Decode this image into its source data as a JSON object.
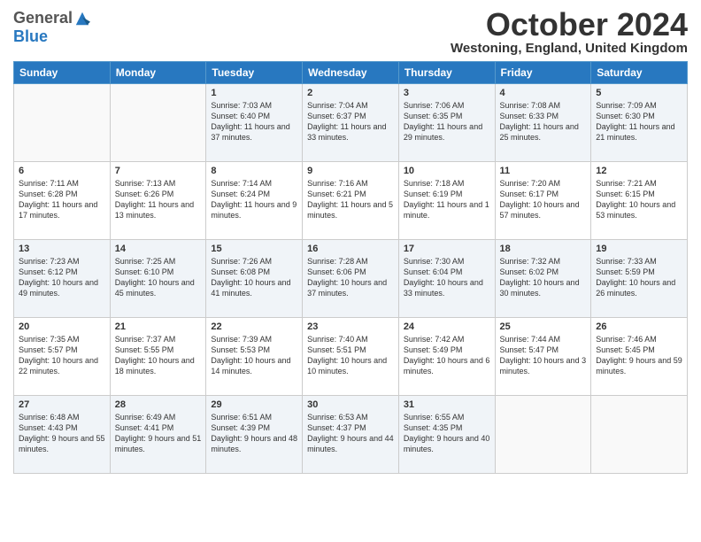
{
  "header": {
    "logo_general": "General",
    "logo_blue": "Blue",
    "month_title": "October 2024",
    "location": "Westoning, England, United Kingdom"
  },
  "days_of_week": [
    "Sunday",
    "Monday",
    "Tuesday",
    "Wednesday",
    "Thursday",
    "Friday",
    "Saturday"
  ],
  "weeks": [
    [
      {
        "day": "",
        "sunrise": "",
        "sunset": "",
        "daylight": ""
      },
      {
        "day": "",
        "sunrise": "",
        "sunset": "",
        "daylight": ""
      },
      {
        "day": "1",
        "sunrise": "Sunrise: 7:03 AM",
        "sunset": "Sunset: 6:40 PM",
        "daylight": "Daylight: 11 hours and 37 minutes."
      },
      {
        "day": "2",
        "sunrise": "Sunrise: 7:04 AM",
        "sunset": "Sunset: 6:37 PM",
        "daylight": "Daylight: 11 hours and 33 minutes."
      },
      {
        "day": "3",
        "sunrise": "Sunrise: 7:06 AM",
        "sunset": "Sunset: 6:35 PM",
        "daylight": "Daylight: 11 hours and 29 minutes."
      },
      {
        "day": "4",
        "sunrise": "Sunrise: 7:08 AM",
        "sunset": "Sunset: 6:33 PM",
        "daylight": "Daylight: 11 hours and 25 minutes."
      },
      {
        "day": "5",
        "sunrise": "Sunrise: 7:09 AM",
        "sunset": "Sunset: 6:30 PM",
        "daylight": "Daylight: 11 hours and 21 minutes."
      }
    ],
    [
      {
        "day": "6",
        "sunrise": "Sunrise: 7:11 AM",
        "sunset": "Sunset: 6:28 PM",
        "daylight": "Daylight: 11 hours and 17 minutes."
      },
      {
        "day": "7",
        "sunrise": "Sunrise: 7:13 AM",
        "sunset": "Sunset: 6:26 PM",
        "daylight": "Daylight: 11 hours and 13 minutes."
      },
      {
        "day": "8",
        "sunrise": "Sunrise: 7:14 AM",
        "sunset": "Sunset: 6:24 PM",
        "daylight": "Daylight: 11 hours and 9 minutes."
      },
      {
        "day": "9",
        "sunrise": "Sunrise: 7:16 AM",
        "sunset": "Sunset: 6:21 PM",
        "daylight": "Daylight: 11 hours and 5 minutes."
      },
      {
        "day": "10",
        "sunrise": "Sunrise: 7:18 AM",
        "sunset": "Sunset: 6:19 PM",
        "daylight": "Daylight: 11 hours and 1 minute."
      },
      {
        "day": "11",
        "sunrise": "Sunrise: 7:20 AM",
        "sunset": "Sunset: 6:17 PM",
        "daylight": "Daylight: 10 hours and 57 minutes."
      },
      {
        "day": "12",
        "sunrise": "Sunrise: 7:21 AM",
        "sunset": "Sunset: 6:15 PM",
        "daylight": "Daylight: 10 hours and 53 minutes."
      }
    ],
    [
      {
        "day": "13",
        "sunrise": "Sunrise: 7:23 AM",
        "sunset": "Sunset: 6:12 PM",
        "daylight": "Daylight: 10 hours and 49 minutes."
      },
      {
        "day": "14",
        "sunrise": "Sunrise: 7:25 AM",
        "sunset": "Sunset: 6:10 PM",
        "daylight": "Daylight: 10 hours and 45 minutes."
      },
      {
        "day": "15",
        "sunrise": "Sunrise: 7:26 AM",
        "sunset": "Sunset: 6:08 PM",
        "daylight": "Daylight: 10 hours and 41 minutes."
      },
      {
        "day": "16",
        "sunrise": "Sunrise: 7:28 AM",
        "sunset": "Sunset: 6:06 PM",
        "daylight": "Daylight: 10 hours and 37 minutes."
      },
      {
        "day": "17",
        "sunrise": "Sunrise: 7:30 AM",
        "sunset": "Sunset: 6:04 PM",
        "daylight": "Daylight: 10 hours and 33 minutes."
      },
      {
        "day": "18",
        "sunrise": "Sunrise: 7:32 AM",
        "sunset": "Sunset: 6:02 PM",
        "daylight": "Daylight: 10 hours and 30 minutes."
      },
      {
        "day": "19",
        "sunrise": "Sunrise: 7:33 AM",
        "sunset": "Sunset: 5:59 PM",
        "daylight": "Daylight: 10 hours and 26 minutes."
      }
    ],
    [
      {
        "day": "20",
        "sunrise": "Sunrise: 7:35 AM",
        "sunset": "Sunset: 5:57 PM",
        "daylight": "Daylight: 10 hours and 22 minutes."
      },
      {
        "day": "21",
        "sunrise": "Sunrise: 7:37 AM",
        "sunset": "Sunset: 5:55 PM",
        "daylight": "Daylight: 10 hours and 18 minutes."
      },
      {
        "day": "22",
        "sunrise": "Sunrise: 7:39 AM",
        "sunset": "Sunset: 5:53 PM",
        "daylight": "Daylight: 10 hours and 14 minutes."
      },
      {
        "day": "23",
        "sunrise": "Sunrise: 7:40 AM",
        "sunset": "Sunset: 5:51 PM",
        "daylight": "Daylight: 10 hours and 10 minutes."
      },
      {
        "day": "24",
        "sunrise": "Sunrise: 7:42 AM",
        "sunset": "Sunset: 5:49 PM",
        "daylight": "Daylight: 10 hours and 6 minutes."
      },
      {
        "day": "25",
        "sunrise": "Sunrise: 7:44 AM",
        "sunset": "Sunset: 5:47 PM",
        "daylight": "Daylight: 10 hours and 3 minutes."
      },
      {
        "day": "26",
        "sunrise": "Sunrise: 7:46 AM",
        "sunset": "Sunset: 5:45 PM",
        "daylight": "Daylight: 9 hours and 59 minutes."
      }
    ],
    [
      {
        "day": "27",
        "sunrise": "Sunrise: 6:48 AM",
        "sunset": "Sunset: 4:43 PM",
        "daylight": "Daylight: 9 hours and 55 minutes."
      },
      {
        "day": "28",
        "sunrise": "Sunrise: 6:49 AM",
        "sunset": "Sunset: 4:41 PM",
        "daylight": "Daylight: 9 hours and 51 minutes."
      },
      {
        "day": "29",
        "sunrise": "Sunrise: 6:51 AM",
        "sunset": "Sunset: 4:39 PM",
        "daylight": "Daylight: 9 hours and 48 minutes."
      },
      {
        "day": "30",
        "sunrise": "Sunrise: 6:53 AM",
        "sunset": "Sunset: 4:37 PM",
        "daylight": "Daylight: 9 hours and 44 minutes."
      },
      {
        "day": "31",
        "sunrise": "Sunrise: 6:55 AM",
        "sunset": "Sunset: 4:35 PM",
        "daylight": "Daylight: 9 hours and 40 minutes."
      },
      {
        "day": "",
        "sunrise": "",
        "sunset": "",
        "daylight": ""
      },
      {
        "day": "",
        "sunrise": "",
        "sunset": "",
        "daylight": ""
      }
    ]
  ]
}
